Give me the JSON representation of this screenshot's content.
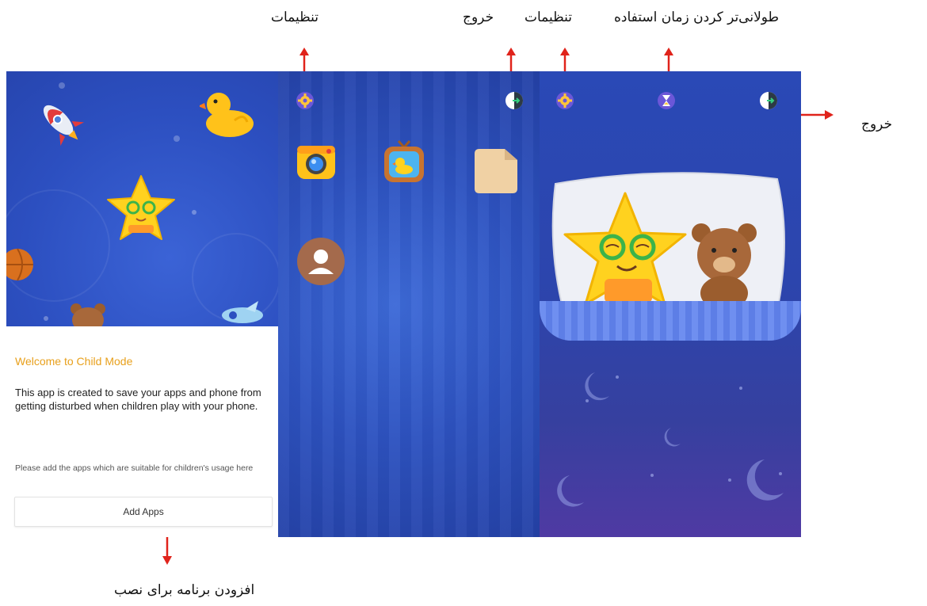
{
  "annotations": {
    "settings_left": "تنظیمات",
    "exit_top": "خروج",
    "settings_mid": "تنظیمات",
    "extend_time": "طولانی‌تر کردن زمان استفاده",
    "exit_right": "خروج",
    "add_app": "افزودن برنامه برای نصب"
  },
  "welcome": {
    "title": "Welcome to Child Mode",
    "body": "This app is created to save your apps and phone from getting disturbed when children play with your phone.",
    "note": "Please add the apps which are suitable for children's usage here",
    "add_apps_label": "Add Apps"
  },
  "colors": {
    "arrow": "#e0231b",
    "accent_orange": "#e8a01c",
    "panel_blue": "#2c4fc0"
  },
  "icons": {
    "panel2_top": [
      "gear-icon",
      "exit-icon"
    ],
    "panel3_top": [
      "gear-icon",
      "hourglass-icon",
      "exit-icon"
    ],
    "apps": [
      "camera-app-icon",
      "tv-duck-app-icon",
      "folder-app-icon",
      "contacts-app-icon"
    ]
  }
}
